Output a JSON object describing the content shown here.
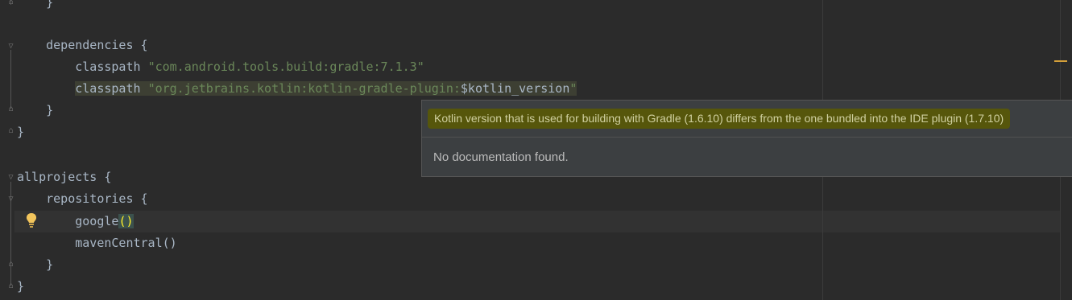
{
  "editor": {
    "lines": [
      {
        "indent": "    ",
        "text": "}"
      },
      {
        "indent": "",
        "text": ""
      },
      {
        "indent": "    ",
        "text": "dependencies {"
      },
      {
        "indent": "        ",
        "keyword": "classpath ",
        "string": "\"com.android.tools.build:gradle:7.1.3\""
      },
      {
        "indent": "        ",
        "keyword": "classpath ",
        "string": "\"org.jetbrains.kotlin:kotlin-gradle-plugin:",
        "template": "$kotlin_version",
        "string_end": "\""
      },
      {
        "indent": "    ",
        "text": "}"
      },
      {
        "indent": "",
        "text": "}"
      },
      {
        "indent": "",
        "text": ""
      },
      {
        "indent": "",
        "text": "allprojects {"
      },
      {
        "indent": "    ",
        "text": "repositories {"
      },
      {
        "indent": "        ",
        "call": "google",
        "parens": "()"
      },
      {
        "indent": "        ",
        "text": "mavenCentral()"
      },
      {
        "indent": "    ",
        "text": "}"
      },
      {
        "indent": "",
        "text": "}"
      }
    ]
  },
  "tooltip": {
    "warning": "Kotlin version that is used for building with Gradle (1.6.10) differs from the one bundled into the IDE plugin (1.7.10)",
    "documentation": "No documentation found."
  },
  "icons": {
    "intention": "lightbulb-icon",
    "fold": "fold-marker-icon"
  },
  "colors": {
    "background": "#2b2b2b",
    "string": "#6a8759",
    "text": "#a9b7c6",
    "warning_bg": "#56560b"
  }
}
